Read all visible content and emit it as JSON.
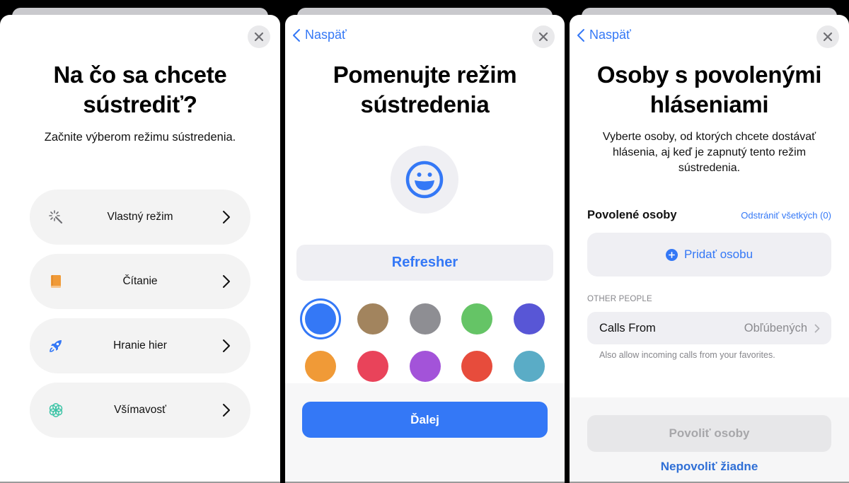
{
  "colors": {
    "accent": "#3478f6",
    "card_bg": "#ffffff",
    "row_bg": "#f3f3f3"
  },
  "panel1": {
    "title": "Na čo sa chcete sústrediť?",
    "subtitle": "Začnite výberom režimu sústredenia.",
    "close_icon": "close-icon",
    "modes": [
      {
        "label": "Vlastný režim",
        "icon": "magic-wand-icon",
        "icon_color": "#6e6e73"
      },
      {
        "label": "Čítanie",
        "icon": "book-icon",
        "icon_color": "#f09a37"
      },
      {
        "label": "Hranie hier",
        "icon": "rocket-icon",
        "icon_color": "#3478f6"
      },
      {
        "label": "Všímavosť",
        "icon": "flower-icon",
        "icon_color": "#3cc4a6"
      }
    ]
  },
  "panel2": {
    "back_label": "Naspäť",
    "title": "Pomenujte režim sústredenia",
    "icon": "smiley-icon",
    "name_value": "Refresher",
    "selected_color_index": 0,
    "swatches": [
      {
        "name": "blue",
        "color": "#3478f6"
      },
      {
        "name": "brown",
        "color": "#a2845e"
      },
      {
        "name": "gray",
        "color": "#8e8e93"
      },
      {
        "name": "green",
        "color": "#65c466"
      },
      {
        "name": "indigo",
        "color": "#5856d6"
      },
      {
        "name": "orange",
        "color": "#f09a37"
      },
      {
        "name": "pink",
        "color": "#e9435a"
      },
      {
        "name": "purple",
        "color": "#a353d9"
      },
      {
        "name": "red",
        "color": "#e74c3c"
      },
      {
        "name": "teal",
        "color": "#5aacc6"
      }
    ],
    "next_label": "Ďalej"
  },
  "panel3": {
    "back_label": "Naspäť",
    "title": "Osoby s povolenými hláseniami",
    "subtitle": "Vyberte osoby, od ktorých chcete dostávať hlásenia, aj keď je zapnutý tento režim sústredenia.",
    "allowed_header": "Povolené osoby",
    "remove_all_label": "Odstrániť všetkých (0)",
    "add_person_label": "Pridať osobu",
    "other_people_label": "OTHER PEOPLE",
    "calls_from_label": "Calls From",
    "calls_from_value": "Obľúbených",
    "calls_footnote": "Also allow incoming calls from your favorites.",
    "allow_button_label": "Povoliť osoby",
    "deny_button_label": "Nepovoliť žiadne"
  }
}
